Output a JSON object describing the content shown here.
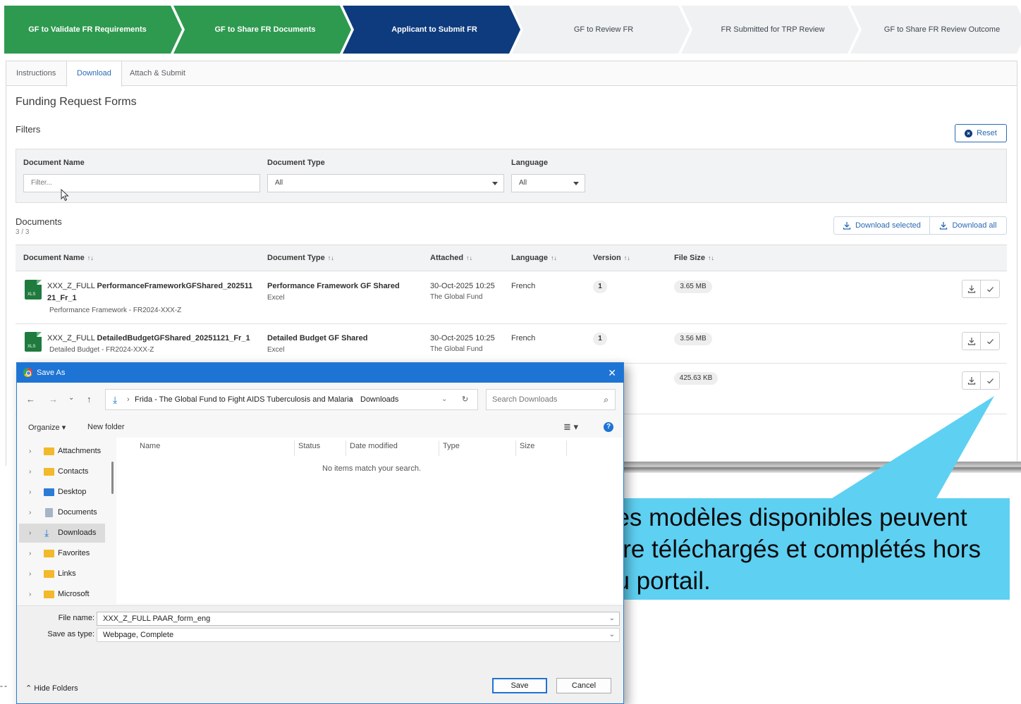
{
  "steps": [
    {
      "label": "GF to Validate FR Requirements",
      "state": "done"
    },
    {
      "label": "GF to Share FR Documents",
      "state": "done"
    },
    {
      "label": "Applicant to Submit FR",
      "state": "current"
    },
    {
      "label": "GF to Review FR",
      "state": "todo"
    },
    {
      "label": "FR Submitted for TRP Review",
      "state": "todo"
    },
    {
      "label": "GF to Share FR Review Outcome",
      "state": "todo"
    }
  ],
  "tabs": {
    "instructions": "Instructions",
    "download": "Download",
    "attach": "Attach & Submit"
  },
  "page": {
    "title": "Funding Request Forms",
    "filters": "Filters",
    "reset": "Reset"
  },
  "filters": {
    "doc_name_label": "Document Name",
    "doc_name_placeholder": "Filter...",
    "doc_type_label": "Document Type",
    "doc_type_value": "All",
    "language_label": "Language",
    "language_value": "All"
  },
  "documents": {
    "label": "Documents",
    "count": "3 / 3",
    "download_selected": "Download selected",
    "download_all": "Download all",
    "columns": {
      "name": "Document Name",
      "type": "Document Type",
      "attached": "Attached",
      "language": "Language",
      "version": "Version",
      "size": "File Size"
    },
    "sort_glyph": "↑↓",
    "rows": [
      {
        "name_prefix": "XXX_Z_FULL",
        "name_main": "PerformanceFrameworkGFShared_202511",
        "name_tail": "21_Fr_1",
        "sub": "Performance Framework - FR2024-XXX-Z",
        "type": "Performance Framework GF Shared",
        "type_sub": "Excel",
        "date": "30-Oct-2025 10:25",
        "by": "The Global Fund",
        "language": "French",
        "version": "1",
        "size": "3.65 MB"
      },
      {
        "name_prefix": "XXX_Z_FULL",
        "name_main": "DetailedBudgetGFShared_20251121_Fr_1",
        "sub": "Detailed Budget - FR2024-XXX-Z",
        "type": "Detailed Budget GF Shared",
        "type_sub": "Excel",
        "date": "30-Oct-2025 10:25",
        "by": "The Global Fund",
        "language": "French",
        "version": "1",
        "size": "3.56 MB"
      },
      {
        "size": "425.63 KB"
      }
    ],
    "file_icon_label": "XLS"
  },
  "dialog": {
    "title": "Save As",
    "path": [
      "Frida - The Global Fund to Fight AIDS Tuberculosis and Malaria",
      "Downloads"
    ],
    "search_placeholder": "Search Downloads",
    "organize": "Organize ▾",
    "new_folder": "New folder",
    "tree": [
      "Attachments",
      "Contacts",
      "Desktop",
      "Documents",
      "Downloads",
      "Favorites",
      "Links",
      "Microsoft Cop"
    ],
    "columns": [
      "Name",
      "Status",
      "Date modified",
      "Type",
      "Size"
    ],
    "empty": "No items match your search.",
    "file_name_label": "File name:",
    "file_name": "XXX_Z_FULL PAAR_form_eng",
    "save_type_label": "Save as type:",
    "save_type": "Webpage, Complete",
    "hide_folders": "Hide Folders",
    "save": "Save",
    "cancel": "Cancel"
  },
  "callout": {
    "text": "Les modèles disponibles peuvent être téléchargés et complétés hors du portail.",
    "color": "#5ed0f2"
  },
  "colors": {
    "done": "#2e9a4f",
    "current": "#0d3b7d",
    "todo": "#f0f1f2",
    "accent": "#2a6ab3",
    "dialog_title": "#1e74d4"
  }
}
